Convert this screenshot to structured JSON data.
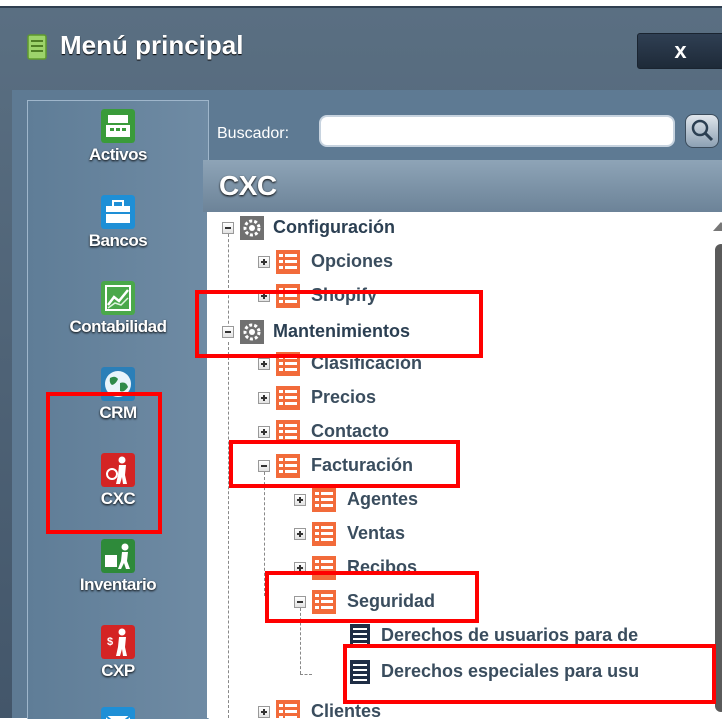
{
  "window": {
    "title": "Menú principal",
    "close_label": "x"
  },
  "sidebar": {
    "items": [
      {
        "label": "Activos",
        "icon": "cash-register-icon",
        "color": "#3a9b3a"
      },
      {
        "label": "Bancos",
        "icon": "briefcase-icon",
        "color": "#1e8fd6"
      },
      {
        "label": "Contabilidad",
        "icon": "chart-icon",
        "color": "#4aa84a"
      },
      {
        "label": "CRM",
        "icon": "globe-icon",
        "color": "#2b7fb8"
      },
      {
        "label": "CXC",
        "icon": "person-bag-icon",
        "color": "#d42424"
      },
      {
        "label": "Inventario",
        "icon": "worker-icon",
        "color": "#2e8a3a"
      },
      {
        "label": "CXP",
        "icon": "person-money-icon",
        "color": "#d42424"
      },
      {
        "label": "",
        "icon": "mail-icon",
        "color": "#1e8fd6"
      }
    ]
  },
  "search": {
    "label": "Buscador:",
    "value": "",
    "placeholder": ""
  },
  "panel": {
    "title": "CXC"
  },
  "tree": {
    "nodes": [
      {
        "label": "Configuración",
        "icon": "gear-icon"
      },
      {
        "label": "Opciones",
        "icon": "list-icon"
      },
      {
        "label": "Shopify",
        "icon": "list-icon"
      },
      {
        "label": "Mantenimientos",
        "icon": "gear-icon"
      },
      {
        "label": "Clasificación",
        "icon": "list-icon"
      },
      {
        "label": "Precios",
        "icon": "list-icon"
      },
      {
        "label": "Contacto",
        "icon": "list-icon"
      },
      {
        "label": "Facturación",
        "icon": "list-icon"
      },
      {
        "label": "Agentes",
        "icon": "list-icon"
      },
      {
        "label": "Ventas",
        "icon": "list-icon"
      },
      {
        "label": "Recibos",
        "icon": "list-icon"
      },
      {
        "label": "Seguridad",
        "icon": "list-icon"
      },
      {
        "label": "Derechos de usuarios para de",
        "icon": "document-icon"
      },
      {
        "label": "Derechos especiales para usu",
        "icon": "document-icon"
      },
      {
        "label": "Clientes",
        "icon": "list-icon"
      }
    ]
  },
  "colors": {
    "highlight": "#ff0000",
    "list_icon": "#f26b3a",
    "window_bg": "#4b5f73"
  }
}
